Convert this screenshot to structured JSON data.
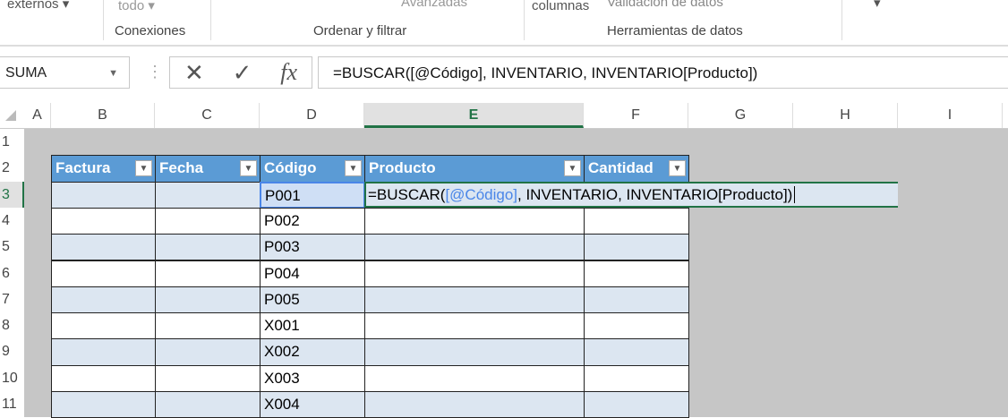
{
  "ribbon": {
    "externos": "externos",
    "todo": "todo",
    "avanzadas": "Avanzadas",
    "columnas": "columnas",
    "validacion": "Validación de datos",
    "groups": [
      "Conexiones",
      "Ordenar y filtrar",
      "Herramientas de datos"
    ]
  },
  "formula_bar": {
    "name_box": "SUMA",
    "cancel": "✕",
    "enter": "✓",
    "fx": "fx",
    "formula": "=BUSCAR([@Código], INVENTARIO, INVENTARIO[Producto])"
  },
  "columns": [
    "A",
    "B",
    "C",
    "D",
    "E",
    "F",
    "G",
    "H",
    "I"
  ],
  "selected_column": "E",
  "rows": [
    "1",
    "2",
    "3",
    "4",
    "5",
    "6",
    "7",
    "8",
    "9",
    "10",
    "11"
  ],
  "table": {
    "headers": [
      "Factura",
      "Fecha",
      "Código",
      "Producto",
      "Cantidad"
    ],
    "codes": [
      "P001",
      "P002",
      "P003",
      "P004",
      "P005",
      "X001",
      "X002",
      "X003",
      "X004"
    ]
  },
  "edit": {
    "prefix": "=BUSCAR(",
    "ref": "[@Código]",
    "suffix": ", INVENTARIO, INVENTARIO[Producto])"
  }
}
